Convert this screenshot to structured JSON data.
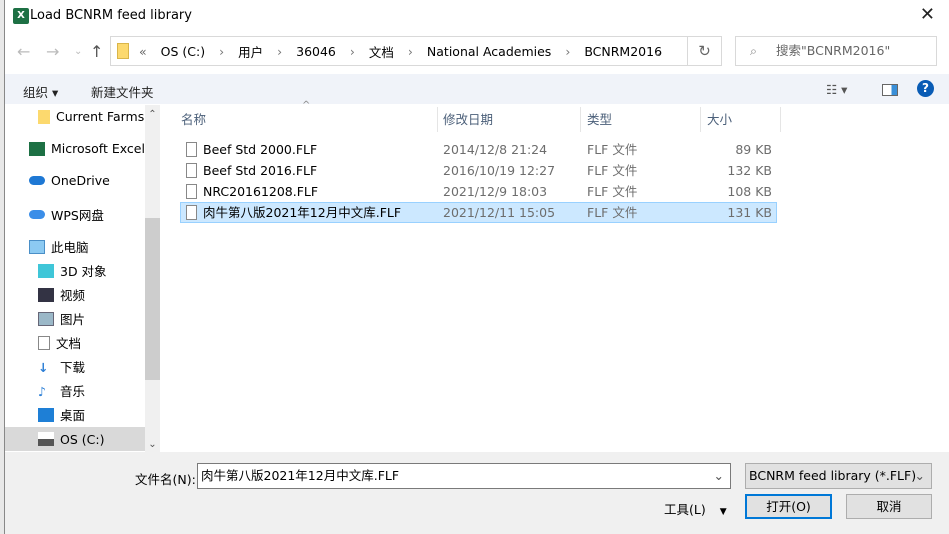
{
  "window": {
    "title": "Load BCNRM feed library",
    "app_icon": "excel-icon"
  },
  "address": {
    "overflow": "«",
    "crumbs": [
      "OS (C:)",
      "用户",
      "36046",
      "文档",
      "National Academies",
      "BCNRM2016"
    ]
  },
  "search": {
    "placeholder": "搜索\"BCNRM2016\""
  },
  "toolbar": {
    "organize": "组织 ▾",
    "new_folder": "新建文件夹"
  },
  "sidebar": {
    "items": [
      {
        "label": "Current Farms",
        "icon": "folder-icon"
      },
      {
        "label": "Microsoft Excel",
        "icon": "excel-icon"
      },
      {
        "label": "OneDrive",
        "icon": "cloud-icon"
      },
      {
        "label": "WPS网盘",
        "icon": "cloud-icon"
      },
      {
        "label": "此电脑",
        "icon": "computer-icon"
      },
      {
        "label": "3D 对象",
        "icon": "cube-icon"
      },
      {
        "label": "视频",
        "icon": "video-icon"
      },
      {
        "label": "图片",
        "icon": "picture-icon"
      },
      {
        "label": "文档",
        "icon": "document-icon"
      },
      {
        "label": "下载",
        "icon": "download-icon"
      },
      {
        "label": "音乐",
        "icon": "music-icon"
      },
      {
        "label": "桌面",
        "icon": "desktop-icon"
      },
      {
        "label": "OS (C:)",
        "icon": "drive-icon"
      }
    ]
  },
  "columns": {
    "name": "名称",
    "date": "修改日期",
    "type": "类型",
    "size": "大小"
  },
  "files": [
    {
      "name": "Beef Std 2000.FLF",
      "date": "2014/12/8 21:24",
      "type": "FLF 文件",
      "size": "89 KB"
    },
    {
      "name": "Beef Std 2016.FLF",
      "date": "2016/10/19 12:27",
      "type": "FLF 文件",
      "size": "132 KB"
    },
    {
      "name": "NRC20161208.FLF",
      "date": "2021/12/9 18:03",
      "type": "FLF 文件",
      "size": "108 KB"
    },
    {
      "name": "肉牛第八版2021年12月中文库.FLF",
      "date": "2021/12/11 15:05",
      "type": "FLF 文件",
      "size": "131 KB",
      "selected": true
    }
  ],
  "bottom": {
    "filename_label": "文件名(N):",
    "filename_value": "肉牛第八版2021年12月中文库.FLF",
    "filter": "BCNRM feed library (*.FLF)",
    "tools": "工具(L)",
    "open": "打开(O)",
    "cancel": "取消"
  }
}
